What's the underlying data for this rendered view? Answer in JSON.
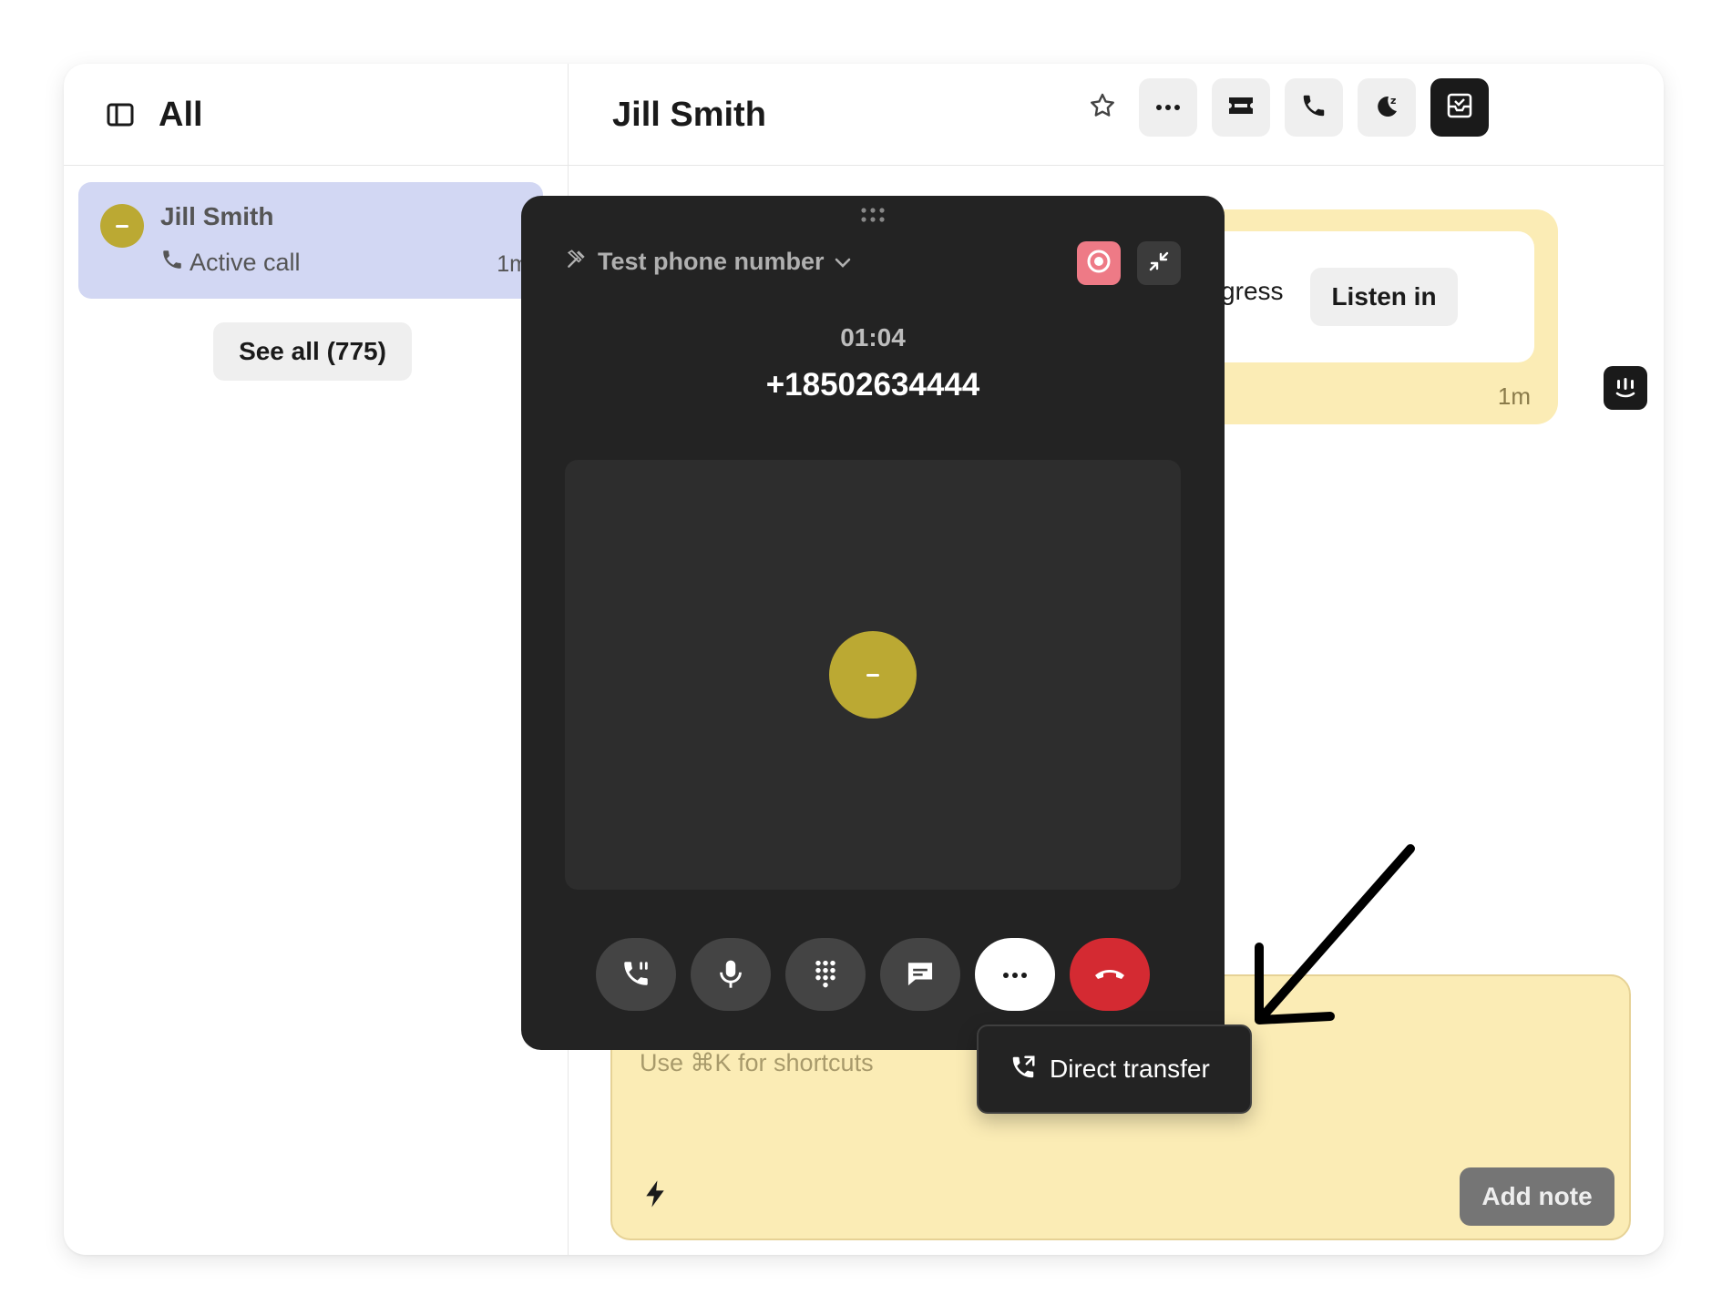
{
  "inbox": {
    "title": "All",
    "conversations": [
      {
        "name": "Jill Smith",
        "status": "Active call",
        "time": "1m"
      }
    ],
    "see_all_label": "See all (775)"
  },
  "conversation": {
    "title": "Jill Smith",
    "header_actions": [
      "star-icon",
      "more-icon",
      "ticket-icon",
      "phone-icon",
      "snooze-icon",
      "close-conversation-icon"
    ]
  },
  "event": {
    "text": "in progress",
    "listen_label": "Listen in",
    "time": "1m"
  },
  "composer": {
    "placeholder": "Use ⌘K for shortcuts",
    "add_note_label": "Add note"
  },
  "call": {
    "line_label": "Test phone number",
    "timer": "01:04",
    "number": "+18502634444",
    "controls": [
      "transfer-icon",
      "microphone-icon",
      "dialpad-icon",
      "message-icon",
      "more-icon",
      "hang-up-icon"
    ],
    "tooltip_label": "Direct transfer"
  },
  "colors": {
    "selected_row": "#d2d7f3",
    "avatar": "#bba933",
    "panel_bg": "#232323",
    "note_bg": "#fbecb5",
    "hang_up": "#d42a32",
    "record": "#ee7a86"
  }
}
